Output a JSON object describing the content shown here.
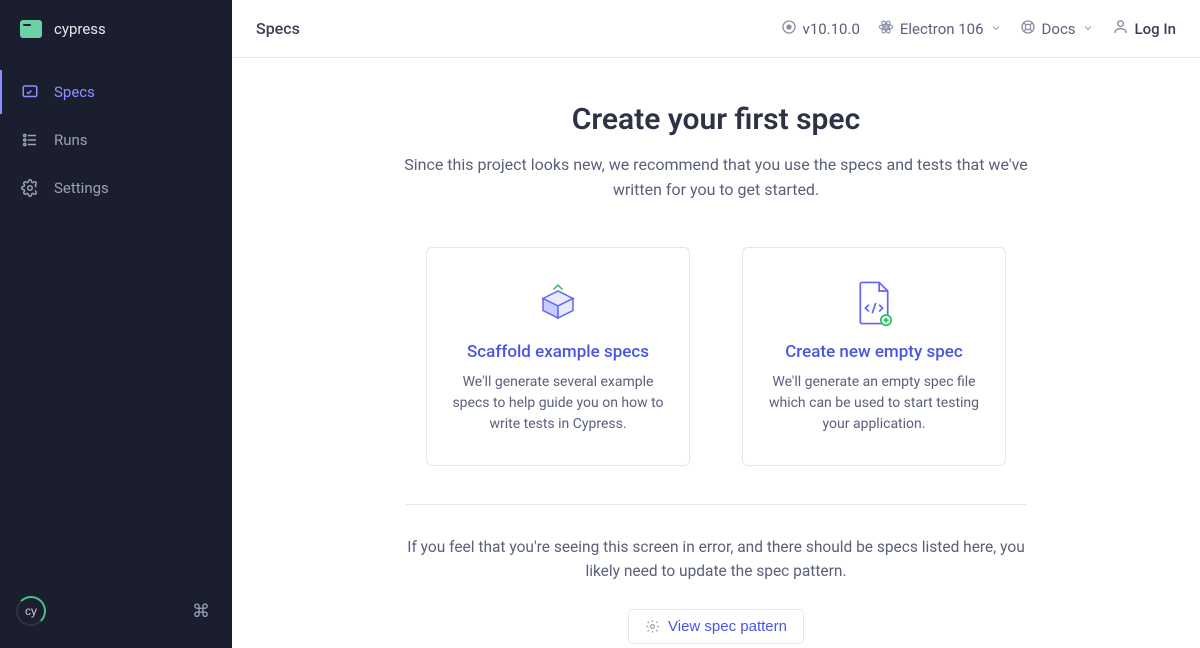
{
  "sidebar": {
    "project_name": "cypress",
    "items": [
      {
        "label": "Specs",
        "icon": "specs-icon",
        "active": true
      },
      {
        "label": "Runs",
        "icon": "runs-icon",
        "active": false
      },
      {
        "label": "Settings",
        "icon": "settings-icon",
        "active": false
      }
    ],
    "badge_text": "cy"
  },
  "topbar": {
    "page_title": "Specs",
    "version": "v10.10.0",
    "browser": "Electron 106",
    "docs": "Docs",
    "login": "Log In"
  },
  "content": {
    "heading": "Create your first spec",
    "subheading": "Since this project looks new, we recommend that you use the specs and tests that we've written for you to get started.",
    "cards": [
      {
        "title": "Scaffold example specs",
        "desc": "We'll generate several example specs to help guide you on how to write tests in Cypress."
      },
      {
        "title": "Create new empty spec",
        "desc": "We'll generate an empty spec file which can be used to start testing your application."
      }
    ],
    "error_text": "If you feel that you're seeing this screen in error, and there should be specs listed here, you likely need to update the spec pattern.",
    "view_pattern_label": "View spec pattern"
  }
}
